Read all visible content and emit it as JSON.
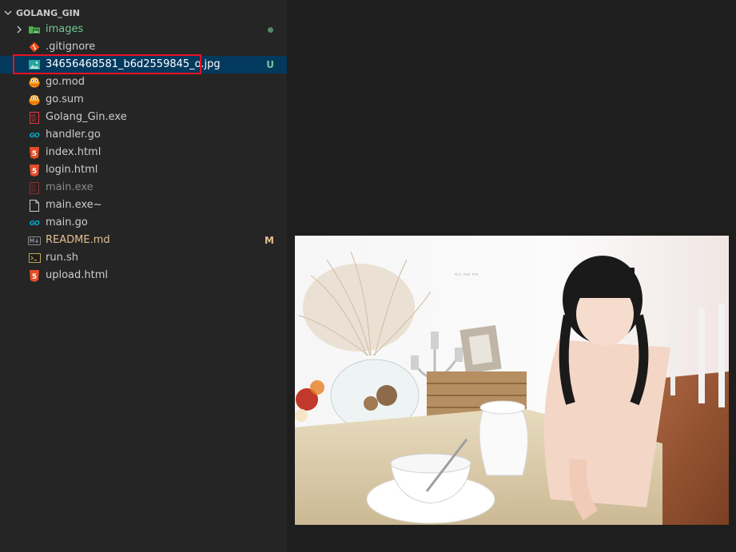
{
  "explorer": {
    "section_title": "GOLANG_GIN",
    "items": [
      {
        "label": "images",
        "icon": "folder-images-icon",
        "color": "#73c991",
        "status": "dot"
      },
      {
        "label": ".gitignore",
        "icon": "git-icon",
        "color": "#cccccc"
      },
      {
        "label": "34656468581_b6d2559845_o.jpg",
        "icon": "image-file-icon",
        "color": "#ffffff",
        "badge": "U"
      },
      {
        "label": "go.mod",
        "icon": "gopher-icon",
        "color": "#cccccc"
      },
      {
        "label": "go.sum",
        "icon": "gopher-icon",
        "color": "#cccccc"
      },
      {
        "label": "Golang_Gin.exe",
        "icon": "binary-file-icon",
        "color": "#cccccc"
      },
      {
        "label": "handler.go",
        "icon": "go-file-icon",
        "color": "#cccccc"
      },
      {
        "label": "index.html",
        "icon": "html5-icon",
        "color": "#cccccc"
      },
      {
        "label": "login.html",
        "icon": "html5-icon",
        "color": "#cccccc"
      },
      {
        "label": "main.exe",
        "icon": "binary-file-icon",
        "color": "#8c8c8c"
      },
      {
        "label": "main.exe~",
        "icon": "file-icon",
        "color": "#cccccc"
      },
      {
        "label": "main.go",
        "icon": "go-file-icon",
        "color": "#cccccc"
      },
      {
        "label": "README.md",
        "icon": "markdown-icon",
        "color": "#e2c08d",
        "badge": "M"
      },
      {
        "label": "run.sh",
        "icon": "terminal-icon",
        "color": "#cccccc"
      },
      {
        "label": "upload.html",
        "icon": "html5-icon",
        "color": "#cccccc"
      }
    ]
  },
  "colors": {
    "sidebar_bg": "#252526",
    "editor_bg": "#1e1e1e",
    "selection_bg": "#04395e",
    "untracked": "#73c991",
    "modified": "#e2c08d",
    "highlight_border": "#e81123"
  },
  "preview": {
    "watermark": "ᵗⁱᶜᶜ ᵐᵃʳ ᵗⁱⁿᵗ"
  }
}
